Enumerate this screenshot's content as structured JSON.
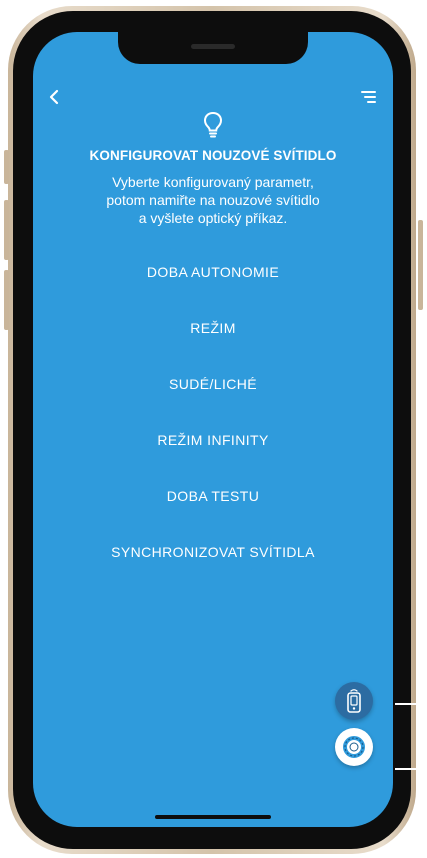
{
  "header": {
    "back_icon": "chevron-left-icon",
    "menu_icon": "menu-lines-icon",
    "bulb_icon": "lightbulb-icon"
  },
  "title": "KONFIGUROVAT NOUZOVÉ SVÍTIDLO",
  "description": [
    "Vyberte konfigurovaný parametr,",
    "potom namiřte na nouzové svítidlo",
    "a vyšlete optický příkaz."
  ],
  "options": [
    "DOBA AUTONOMIE",
    "REŽIM",
    "SUDÉ/LICHÉ",
    "REŽIM INFINITY",
    "DOBA TESTU",
    "SYNCHRONIZOVAT SVÍTIDLA"
  ],
  "fabs": {
    "remote_icon": "phone-remote-icon",
    "camera_icon": "lens-icon"
  },
  "colors": {
    "screen_background": "#2f9bdc",
    "remote_fab": "#2c6ca2",
    "text": "#ffffff"
  }
}
